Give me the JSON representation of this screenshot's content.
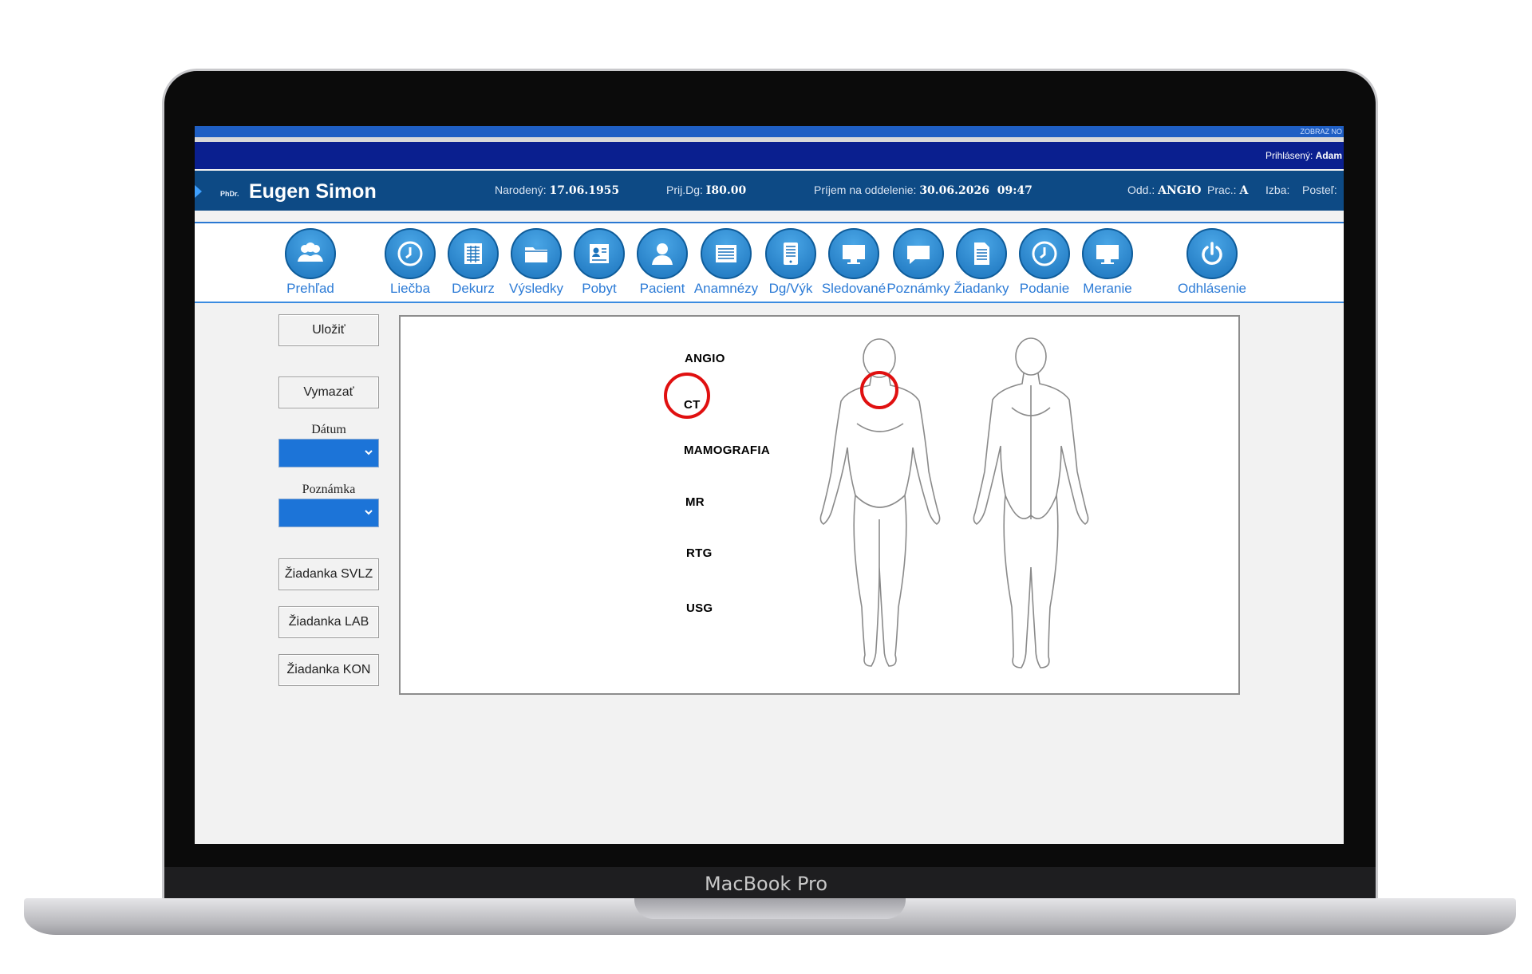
{
  "device": {
    "brand": "MacBook Pro"
  },
  "top_bar": {
    "notify_text": "ZOBRAZ NO"
  },
  "user_bar": {
    "label": "Prihlásený:",
    "user": "Adam"
  },
  "patient": {
    "title": "PhDr.",
    "name": "Eugen Simon",
    "born_label": "Narodený:",
    "born_value": "17.06.1955",
    "dg_label": "Prij.Dg:",
    "dg_value": "I80.00",
    "admit_label": "Príjem na oddelenie:",
    "admit_value": "30.06.2026  09:47",
    "dept_label": "Odd.:",
    "dept_value": "ANGIO",
    "prac_label": "Prac.:",
    "prac_value": "A",
    "room_label": "Izba:",
    "bed_label": "Posteľ:"
  },
  "toolbar": [
    {
      "label": "Prehľad",
      "icon": "users-icon"
    },
    {
      "label": "Liečba",
      "icon": "clock-icon"
    },
    {
      "label": "Dekurz",
      "icon": "table-icon"
    },
    {
      "label": "Výsledky",
      "icon": "folder-icon"
    },
    {
      "label": "Pobyt",
      "icon": "id-card-icon"
    },
    {
      "label": "Pacient",
      "icon": "person-icon"
    },
    {
      "label": "Anamnézy",
      "icon": "list-icon"
    },
    {
      "label": "Dg/Výk",
      "icon": "tablet-icon"
    },
    {
      "label": "Sledované",
      "icon": "monitor-icon"
    },
    {
      "label": "Poznámky",
      "icon": "chat-icon"
    },
    {
      "label": "Žiadanky",
      "icon": "document-icon"
    },
    {
      "label": "Podanie",
      "icon": "clock-icon"
    },
    {
      "label": "Meranie",
      "icon": "monitor-icon"
    },
    {
      "label": "Odhlásenie",
      "icon": "power-icon"
    }
  ],
  "form": {
    "save": "Uložiť",
    "delete": "Vymazať",
    "date_label": "Dátum",
    "date_value": "",
    "note_label": "Poznámka",
    "note_value": "",
    "req_svlz": "Žiadanka SVLZ",
    "req_lab": "Žiadanka LAB",
    "req_kon": "Žiadanka KON"
  },
  "modalities": [
    "ANGIO",
    "CT",
    "MAMOGRAFIA",
    "MR",
    "RTG",
    "USG"
  ],
  "selected_modality": "CT",
  "colors": {
    "accent": "#1c74bd",
    "header": "#0d4a85",
    "user_bar": "#0a1f8f",
    "marker": "#e01010"
  }
}
